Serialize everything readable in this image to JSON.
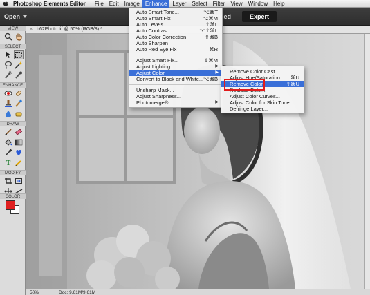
{
  "menubar": {
    "app_name": "Photoshop Elements Editor",
    "menus": [
      "File",
      "Edit",
      "Image",
      "Enhance",
      "Layer",
      "Select",
      "Filter",
      "View",
      "Window",
      "Help"
    ],
    "active_menu": "Enhance"
  },
  "appbar": {
    "open_label": "Open",
    "mode_guided": "uided",
    "mode_expert": "Expert"
  },
  "toolpanel": {
    "sections": [
      "VIEW",
      "SELECT",
      "ENHANCE",
      "DRAW",
      "MODIFY",
      "COLOR"
    ]
  },
  "document": {
    "tab_title": "b62Photo.tif @ 50% (RGB/8) *",
    "status_zoom": "50%",
    "status_doc": "Doc: 9.61M/9.61M"
  },
  "enhance_menu": {
    "items": [
      {
        "label": "Auto Smart Tone...",
        "shortcut": "⌥⌘T"
      },
      {
        "label": "Auto Smart Fix",
        "shortcut": "⌥⌘M"
      },
      {
        "label": "Auto Levels",
        "shortcut": "⇧⌘L"
      },
      {
        "label": "Auto Contrast",
        "shortcut": "⌥⇧⌘L"
      },
      {
        "label": "Auto Color Correction",
        "shortcut": "⇧⌘B"
      },
      {
        "label": "Auto Sharpen",
        "shortcut": ""
      },
      {
        "label": "Auto Red Eye Fix",
        "shortcut": "⌘R"
      },
      {
        "label": "Adjust Smart Fix...",
        "shortcut": "⇧⌘M"
      },
      {
        "label": "Adjust Lighting",
        "shortcut": ""
      },
      {
        "label": "Adjust Color",
        "shortcut": ""
      },
      {
        "label": "Convert to Black and White...",
        "shortcut": "⌥⌘B"
      },
      {
        "label": "Unsharp Mask...",
        "shortcut": ""
      },
      {
        "label": "Adjust Sharpness...",
        "shortcut": ""
      },
      {
        "label": "Photomerge®...",
        "shortcut": ""
      }
    ]
  },
  "adjust_color_menu": {
    "items": [
      {
        "label": "Remove Color Cast...",
        "shortcut": ""
      },
      {
        "label": "Adjust Hue/Saturation...",
        "shortcut": "⌘U"
      },
      {
        "label": "Remove Color",
        "shortcut": "⇧⌘U"
      },
      {
        "label": "Replace Color...",
        "shortcut": ""
      },
      {
        "label": "Adjust Color Curves...",
        "shortcut": ""
      },
      {
        "label": "Adjust Color for Skin Tone...",
        "shortcut": ""
      },
      {
        "label": "Defringe Layer...",
        "shortcut": ""
      }
    ]
  },
  "colors": {
    "menu_highlight": "#3a6fd8",
    "foreground_color": "#e02020",
    "background_color": "#ffffff",
    "annotation_box": "#e11b1b"
  }
}
